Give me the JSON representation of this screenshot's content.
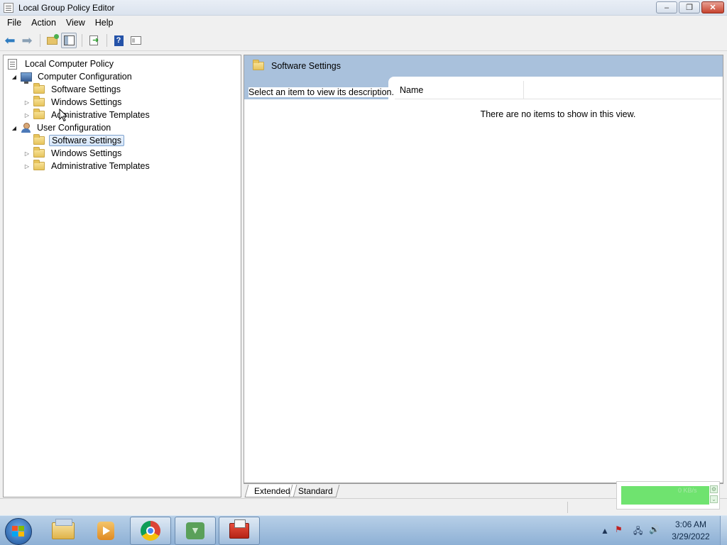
{
  "window": {
    "title": "Local Group Policy Editor",
    "controls": {
      "minimize": "–",
      "restore": "❐",
      "close": "✕"
    }
  },
  "menu": [
    "File",
    "Action",
    "View",
    "Help"
  ],
  "toolbar": {
    "icons": [
      "back-arrow-icon",
      "forward-arrow-icon",
      "up-folder-icon",
      "show-hide-tree-icon",
      "export-list-icon",
      "help-icon",
      "properties-icon"
    ]
  },
  "tree": {
    "root": "Local Computer Policy",
    "computer": {
      "label": "Computer Configuration",
      "children": [
        "Software Settings",
        "Windows Settings",
        "Administrative Templates"
      ]
    },
    "user": {
      "label": "User Configuration",
      "children": [
        "Software Settings",
        "Windows Settings",
        "Administrative Templates"
      ]
    },
    "selected": "User Configuration / Software Settings"
  },
  "details": {
    "header_title": "Software Settings",
    "description": "Select an item to view its description.",
    "column_name": "Name",
    "empty_message": "There are no items to show in this view."
  },
  "view_tabs": [
    "Extended",
    "Standard"
  ],
  "network_meter": {
    "value": "0 KB/s"
  },
  "taskbar": {
    "apps": [
      "start-orb",
      "windows-explorer",
      "media-player",
      "google-chrome",
      "installer",
      "toolbox"
    ],
    "clock_time": "3:06 AM",
    "clock_date": "3/29/2022"
  },
  "colors": {
    "header_blue": "#a9c1dc",
    "selection_border": "#7da2ce",
    "close_red": "#c7432e",
    "meter_green": "#6fe36f"
  }
}
